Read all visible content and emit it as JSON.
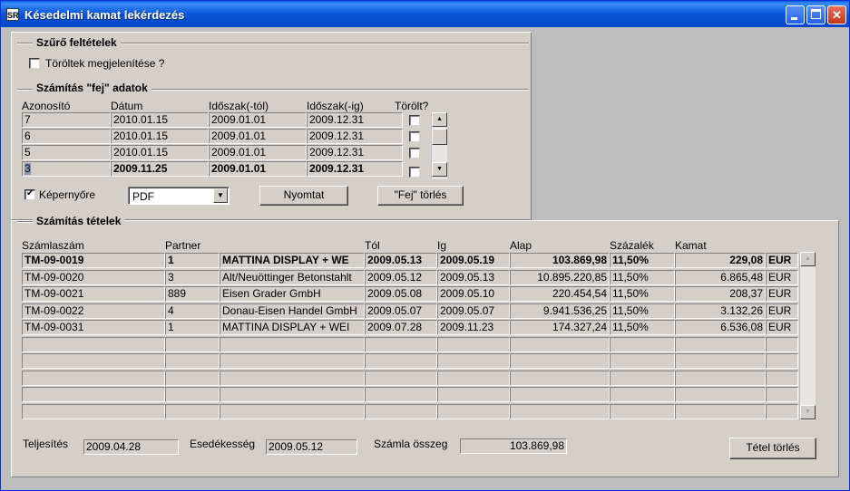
{
  "window": {
    "title": "Késedelmi kamat lekérdezés",
    "app_icon_text": "SR"
  },
  "filter": {
    "group_title": "Szűrő feltételek",
    "show_deleted_label": "Töröltek megjelenítése ?",
    "show_deleted_checked": false
  },
  "header_data": {
    "group_title": "Számítás \"fej\" adatok",
    "columns": [
      "Azonosító",
      "Dátum",
      "Időszak(-tól)",
      "Időszak(-ig)",
      "Törölt?"
    ],
    "rows": [
      {
        "id": "7",
        "date": "2010.01.15",
        "from": "2009.01.01",
        "to": "2009.12.31",
        "deleted": false
      },
      {
        "id": "6",
        "date": "2010.01.15",
        "from": "2009.01.01",
        "to": "2009.12.31",
        "deleted": false
      },
      {
        "id": "5",
        "date": "2010.01.15",
        "from": "2009.01.01",
        "to": "2009.12.31",
        "deleted": false
      },
      {
        "id": "3",
        "date": "2009.11.25",
        "from": "2009.01.01",
        "to": "2009.12.31",
        "deleted": false
      }
    ],
    "selected_index": 3
  },
  "output": {
    "screen_label": "Képernyőre",
    "screen_checked": true,
    "format_value": "PDF",
    "print_button": "Nyomtat",
    "delete_header_button": "\"Fej\" törlés"
  },
  "items": {
    "group_title": "Számítás tételek",
    "columns": [
      "Számlaszám",
      "Partner",
      "",
      "Tól",
      "Ig",
      "Alap",
      "Százalék",
      "Kamat",
      ""
    ],
    "rows": [
      {
        "invoice": "TM-09-0019",
        "partner_id": "1",
        "partner": "MATTINA DISPLAY + WE",
        "from": "2009.05.13",
        "to": "2009.05.19",
        "base": "103.869,98",
        "percent": "11,50%",
        "interest": "229,08",
        "currency": "EUR"
      },
      {
        "invoice": "TM-09-0020",
        "partner_id": "3",
        "partner": "Alt/Neuöttinger Betonstahlt",
        "from": "2009.05.12",
        "to": "2009.05.13",
        "base": "10.895.220,85",
        "percent": "11,50%",
        "interest": "6.865,48",
        "currency": "EUR"
      },
      {
        "invoice": "TM-09-0021",
        "partner_id": "889",
        "partner": "Eisen Grader GmbH",
        "from": "2009.05.08",
        "to": "2009.05.10",
        "base": "220.454,54",
        "percent": "11,50%",
        "interest": "208,37",
        "currency": "EUR"
      },
      {
        "invoice": "TM-09-0022",
        "partner_id": "4",
        "partner": "Donau-Eisen Handel GmbH",
        "from": "2009.05.07",
        "to": "2009.05.07",
        "base": "9.941.536,25",
        "percent": "11,50%",
        "interest": "3.132,26",
        "currency": "EUR"
      },
      {
        "invoice": "TM-09-0031",
        "partner_id": "1",
        "partner": "MATTINA DISPLAY + WEI",
        "from": "2009.07.28",
        "to": "2009.11.23",
        "base": "174.327,24",
        "percent": "11,50%",
        "interest": "6.536,08",
        "currency": "EUR"
      }
    ],
    "empty_rows": 5,
    "selected_index": 0
  },
  "footer": {
    "performance_label": "Teljesítés",
    "performance_value": "2009.04.28",
    "due_label": "Esedékesség",
    "due_value": "2009.05.12",
    "amount_label": "Számla összeg",
    "amount_value": "103.869,98",
    "delete_item_button": "Tétel törlés"
  }
}
